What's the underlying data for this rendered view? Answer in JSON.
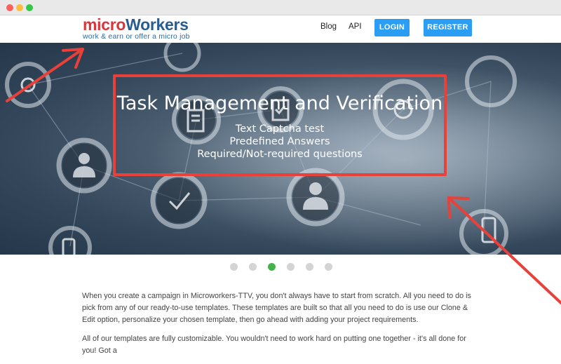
{
  "logo": {
    "micro": "micro",
    "workers": "Workers",
    "tagline": "work & earn or offer a micro job"
  },
  "nav": {
    "blog": "Blog",
    "api": "API",
    "login": "LOGIN",
    "register": "REGISTER"
  },
  "hero": {
    "title": "Task Management and Verification",
    "lines": [
      "Text Captcha test",
      "Predefined Answers",
      "Required/Not-required questions"
    ]
  },
  "carousel": {
    "count": 6,
    "active_index": 2
  },
  "content": {
    "paragraphs": [
      "When you create a campaign in Microworkers-TTV, you don't always have to start from scratch. All you need to do is pick from any of our ready-to-use templates. These templates are built so that all you need to do is use our Clone & Edit option, personalize your chosen template, then go ahead with adding your project requirements.",
      "All of our templates are fully customizable. You wouldn't need to work hard on putting one together - it's all done for you! Got a"
    ]
  },
  "colors": {
    "brand_red": "#d9353b",
    "brand_blue": "#2a5d8f",
    "button_blue": "#2a9df4",
    "annotation_red": "#e8413a",
    "active_dot": "#42b34a"
  }
}
